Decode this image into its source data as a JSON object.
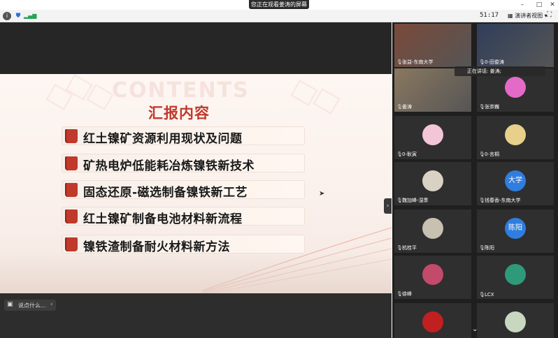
{
  "titlebar": {
    "sharing": "您正在观看姜涛的屏幕",
    "minimize": "–",
    "maximize": "□",
    "close": "✕"
  },
  "toolbar": {
    "timer": "51:17",
    "view_mode": "演讲者视图 ▾"
  },
  "slide": {
    "watermark": "CONTENTS",
    "title": "汇报内容",
    "items": [
      "红土镍矿资源利用现状及问题",
      "矿热电炉低能耗冶炼镍铁新技术",
      "固态还原-磁选制备镍铁新工艺",
      "红土镍矿制备电池材料新流程",
      "镍铁渣制备耐火材料新方法"
    ],
    "accent_color": "#c0392b"
  },
  "slide_controls": [
    "‹",
    "›",
    "✎",
    "⌕",
    "▭",
    "⋯"
  ],
  "chat": {
    "placeholder": "说点什么...",
    "collapse": "‹"
  },
  "speaking": "正在讲话: 姜涛;",
  "participants": [
    {
      "name": "张益-东南大学",
      "kind": "photo",
      "color": "#7a4a3a"
    },
    {
      "name": "0-田俊涛",
      "kind": "photo",
      "color": "#2f3e5a"
    },
    {
      "name": "姜涛",
      "kind": "photo",
      "color": "#8a7860"
    },
    {
      "name": "张崇巍",
      "kind": "avatar",
      "color": "#e46ac8"
    },
    {
      "name": "0-耿寅",
      "kind": "avatar",
      "color": "#f2c6d6"
    },
    {
      "name": "0-言桐",
      "kind": "avatar",
      "color": "#e6d08a"
    },
    {
      "name": "魏加峰-湿季",
      "kind": "avatar",
      "color": "#d9d2c4"
    },
    {
      "name": "钱春香-东南大学",
      "kind": "text-avatar",
      "text": "大学",
      "color": "#2f7de0"
    },
    {
      "name": "杭桂平",
      "kind": "avatar",
      "color": "#c8c0b0"
    },
    {
      "name": "陈阳",
      "kind": "text-avatar",
      "text": "陈阳",
      "color": "#2f7de0"
    },
    {
      "name": "徐峰",
      "kind": "avatar",
      "color": "#c24a6a"
    },
    {
      "name": "LCX",
      "kind": "avatar",
      "color": "#2e9a7a"
    },
    {
      "name": "",
      "kind": "avatar",
      "color": "#c02020"
    },
    {
      "name": "",
      "kind": "avatar",
      "color": "#c8d8c0"
    }
  ]
}
